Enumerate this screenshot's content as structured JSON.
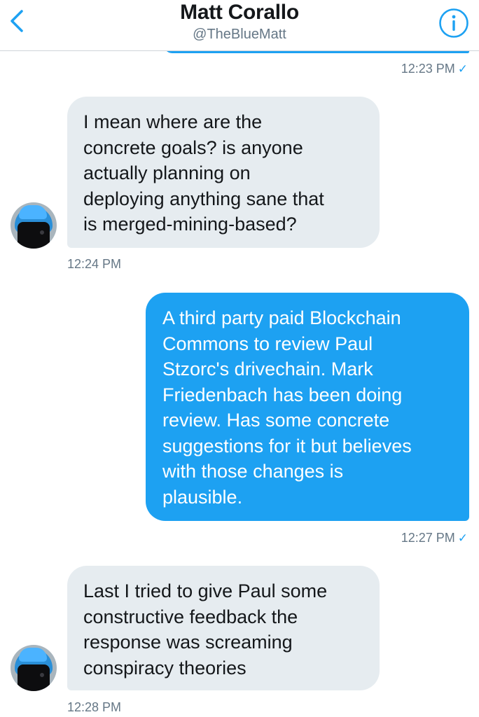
{
  "header": {
    "name": "Matt Corallo",
    "handle": "@TheBlueMatt",
    "back_icon": "chevron-left-icon",
    "info_icon": "info-icon"
  },
  "colors": {
    "accent": "#1da1f2",
    "incoming_bubble": "#e6ecf0",
    "timestamp": "#657786"
  },
  "messages": [
    {
      "direction": "outgoing",
      "timestamp": "12:23 PM",
      "seen_icon": "checkmark-icon"
    },
    {
      "direction": "incoming",
      "text": "I mean where are the\nconcrete goals? is anyone\nactually planning on\ndeploying anything sane that\nis merged-mining-based?",
      "timestamp": "12:24 PM"
    },
    {
      "direction": "outgoing",
      "text": "A third party paid Blockchain\nCommons to review Paul\nStzorc's drivechain. Mark\nFriedenbach has been doing\nreview. Has some concrete\nsuggestions for it but believes\nwith those changes is\nplausible.",
      "timestamp": "12:27 PM",
      "seen_icon": "checkmark-icon"
    },
    {
      "direction": "incoming",
      "text": "Last I tried to give Paul some\nconstructive feedback the\nresponse was screaming\nconspiracy theories",
      "timestamp": "12:28 PM"
    }
  ]
}
